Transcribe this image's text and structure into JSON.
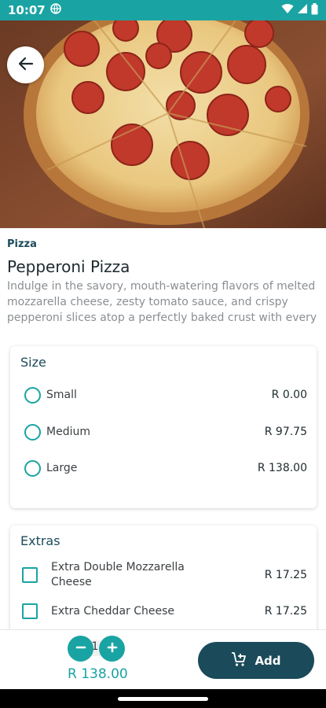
{
  "status_bar": {
    "time": "10:07"
  },
  "product": {
    "category": "Pizza",
    "name": "Pepperoni Pizza",
    "description": "Indulge in the savory, mouth-watering flavors of melted mozzarella cheese, zesty tomato sauce, and crispy pepperoni slices atop a perfectly baked crust with every"
  },
  "size_section": {
    "title": "Size",
    "options": [
      {
        "label": "Small",
        "price": "R 0.00"
      },
      {
        "label": "Medium",
        "price": "R 97.75"
      },
      {
        "label": "Large",
        "price": "R 138.00"
      }
    ]
  },
  "extras_section": {
    "title": "Extras",
    "options": [
      {
        "label": "Extra Double Mozzarella Cheese",
        "price": "R 17.25"
      },
      {
        "label": "Extra Cheddar Cheese",
        "price": "R 17.25"
      }
    ]
  },
  "cart": {
    "quantity": "1",
    "total": "R 138.00",
    "add_label": "Add"
  },
  "colors": {
    "accent": "#1aa3a3",
    "primary": "#1b4b5a"
  }
}
